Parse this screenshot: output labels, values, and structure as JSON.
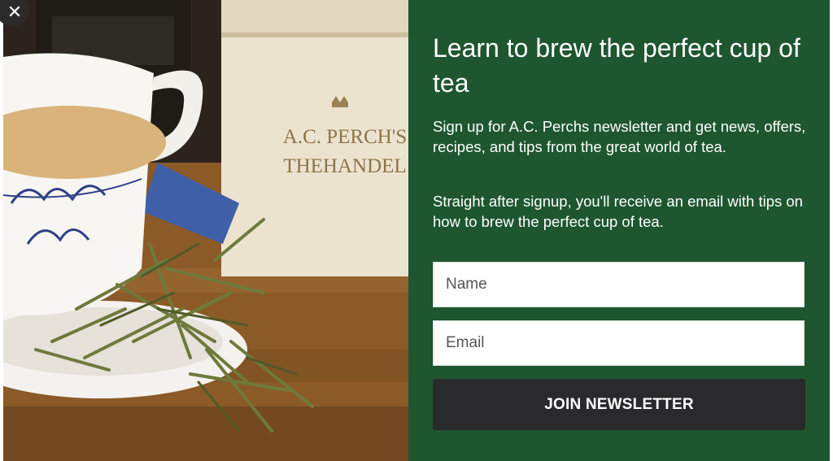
{
  "close": {
    "icon": "close-icon",
    "glyph": "✕"
  },
  "photo": {
    "tin_brand_line1": "A.C. PERCH'S",
    "tin_brand_line2": "THEHANDEL"
  },
  "panel": {
    "headline": "Learn to brew the perfect cup of tea",
    "paragraph_1": "Sign up for A.C. Perchs newsletter and get news, offers, recipes, and tips from the great world of tea.",
    "paragraph_2": "Straight after signup, you'll receive an email with tips on how to brew the perfect cup of tea.",
    "name_placeholder": "Name",
    "email_placeholder": "Email",
    "join_label": "JOIN NEWSLETTER"
  },
  "colors": {
    "panel_bg": "#1e5630",
    "button_bg": "#2a2a2c",
    "text": "#ffffff"
  }
}
